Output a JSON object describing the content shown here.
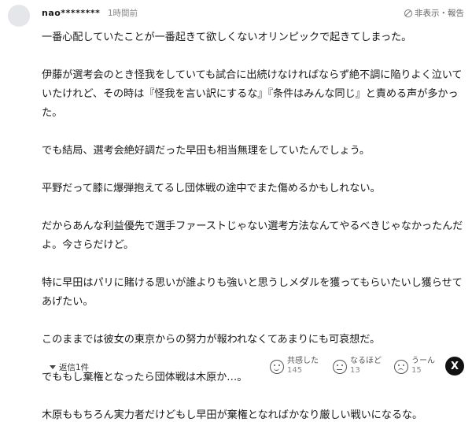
{
  "comment": {
    "username": "nao********",
    "timestamp": "1時間前",
    "report_label": "非表示・報告",
    "paragraphs": [
      "一番心配していたことが一番起きて欲しくないオリンピックで起きてしまった。",
      "伊藤が選考会のとき怪我をしていても試合に出続けなければならず絶不調に陥りよく泣いていたけれど、その時は『怪我を言い訳にするな』『条件はみんな同じ』と責める声が多かった。",
      "でも結局、選考会絶好調だった早田も相当無理をしていたんでしょう。",
      "平野だって膝に爆弾抱えてるし団体戦の途中でまた傷めるかもしれない。",
      "だからあんな利益優先で選手ファーストじゃない選考方法なんてやるべきじゃなかったんだよ。今さらだけど。",
      "特に早田はパリに賭ける思いが誰よりも強いと思うしメダルを獲ってもらいたいし獲らせてあげたい。",
      "このままでは彼女の東京からの努力が報われなくてあまりにも可哀想だ。",
      "でももし棄権となったら団体戦は木原か…。",
      "木原ももちろん実力者だけどもし早田が棄権となればかなり厳しい戦いになるな。"
    ]
  },
  "footer": {
    "replies_label": "返信1件",
    "reactions": [
      {
        "label": "共感した",
        "count": "145",
        "icon": "smile-icon"
      },
      {
        "label": "なるほど",
        "count": "13",
        "icon": "neutral-face-icon"
      },
      {
        "label": "うーん",
        "count": "15",
        "icon": "hmm-face-icon"
      }
    ],
    "share_icon_label": "X"
  }
}
